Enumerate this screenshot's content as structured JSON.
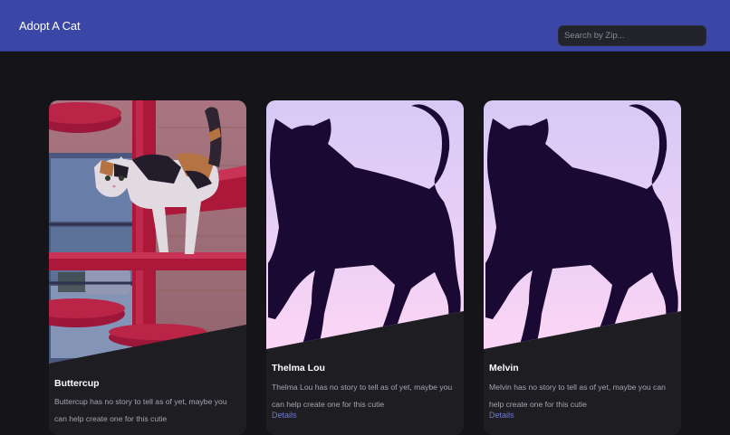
{
  "header": {
    "brand": "Adopt A Cat",
    "search_placeholder": "Search by Zip..."
  },
  "cards": [
    {
      "name": "Buttercup",
      "description": "Buttercup has no story to tell as of yet, maybe you can help create one for this cutie",
      "image": "calico-cat-photo",
      "link": ""
    },
    {
      "name": "Thelma Lou",
      "description": "Thelma Lou has no story to tell as of yet, maybe you can help create one for this cutie",
      "image": "cat-silhouette-placeholder",
      "link": "Details"
    },
    {
      "name": "Melvin",
      "description": "Melvin has no story to tell as of yet, maybe you can help create one for this cutie",
      "image": "cat-silhouette-placeholder",
      "link": "Details"
    }
  ],
  "colors": {
    "navbar": "#3a47a6",
    "background": "#151519",
    "card": "#1d1d22",
    "link": "#6e7ad8",
    "silhouette": "#1a0a33",
    "placeholder_gradient_top": "#d9cbf7",
    "placeholder_gradient_bottom": "#ffd9f7"
  }
}
